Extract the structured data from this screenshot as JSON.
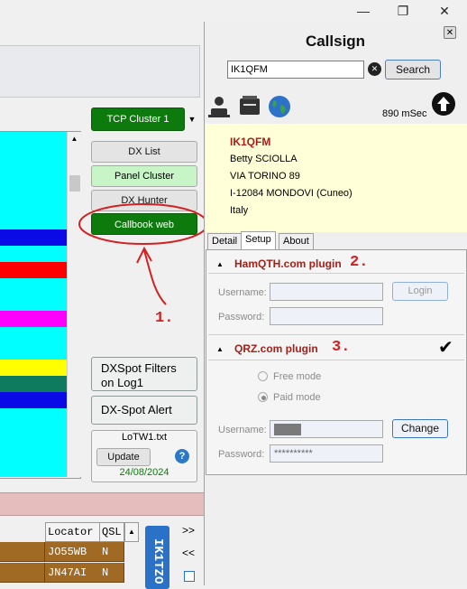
{
  "window": {
    "minimize": "—",
    "restore": "❐",
    "close": "✕"
  },
  "left": {
    "cluster_select": "TCP Cluster 1",
    "buttons": {
      "dx_list": "DX List",
      "panel_cluster": "Panel Cluster",
      "dx_hunter": "DX Hunter",
      "callbook_web": "Callbook web"
    },
    "dxspot_filters": "DXSpot Filters on Log1",
    "dxspot_alert": "DX-Spot Alert",
    "lotw": {
      "file": "LoTW1.txt",
      "update": "Update",
      "help": "?",
      "date": "24/08/2024"
    },
    "annotation": "1.",
    "table": {
      "headers": [
        "Locator",
        "QSL"
      ],
      "rows": [
        [
          "JO55WB",
          "N"
        ],
        [
          "JN47AI",
          "N"
        ]
      ]
    },
    "side_callsign": "IK1TZO",
    "nav": {
      "next": ">>",
      "prev": "<<"
    }
  },
  "panel": {
    "title": "Callsign",
    "close": "✕",
    "search_value": "IK1QFM",
    "search_button": "Search",
    "latency": "890 mSec",
    "info": {
      "callsign": "IK1QFM",
      "name": "Betty SCIOLLA",
      "address": "VIA TORINO 89",
      "city": "I-12084 MONDOVI (Cuneo)",
      "country": "Italy"
    },
    "tabs": [
      "Detail",
      "Setup",
      "About"
    ],
    "hamqth": {
      "title": "HamQTH.com plugin",
      "annotation": "2.",
      "username_label": "Username:",
      "password_label": "Password:",
      "login_button": "Login"
    },
    "qrz": {
      "title": "QRZ.com plugin",
      "annotation": "3.",
      "free_mode": "Free mode",
      "paid_mode": "Paid mode",
      "username_label": "Username:",
      "password_label": "Password:",
      "password_value": "**********",
      "change_button": "Change"
    }
  },
  "colors": {
    "accent_green": "#0c7a0c",
    "annotation_red": "#d42020",
    "cyan": "#00ffff",
    "info_bg": "#ffffd8"
  }
}
